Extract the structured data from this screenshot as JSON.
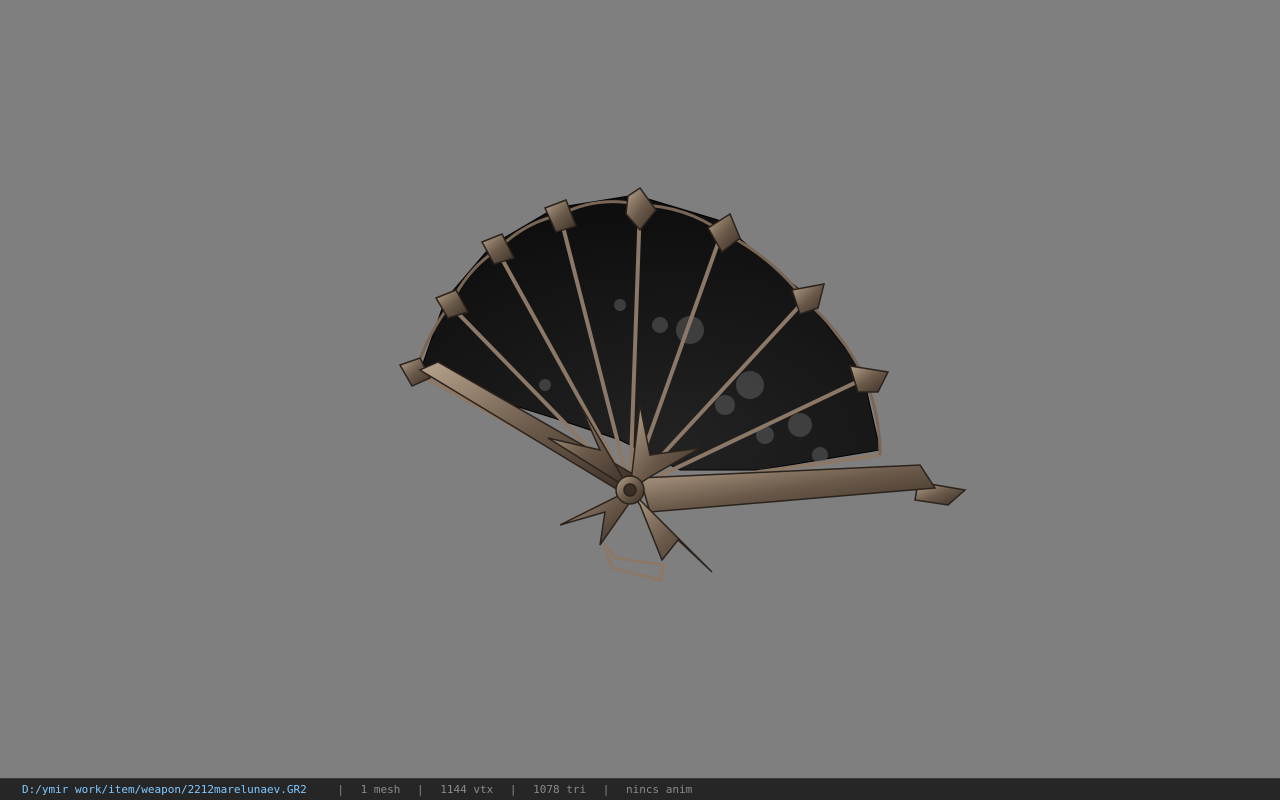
{
  "viewport": {
    "background_color": "#7f7f7f",
    "model": {
      "object": "ornate folding fan",
      "colors": {
        "leaf": "#151515",
        "leaf_shadow": "#0b0b0b",
        "frame": "#6b5a4a",
        "frame_highlight": "#a89580",
        "flower": "#6e6e6e"
      }
    }
  },
  "status_bar": {
    "file_path": "D:/ymir work/item/weapon/2212marelunaev.GR2",
    "separator": "|",
    "mesh_count": "1 mesh",
    "vertex_count": "1144 vtx",
    "triangle_count": "1078 tri",
    "anim_info": "nincs anim",
    "path_color": "#7fc7ff",
    "text_color": "#8a8a8a",
    "background_color": "#262626"
  }
}
